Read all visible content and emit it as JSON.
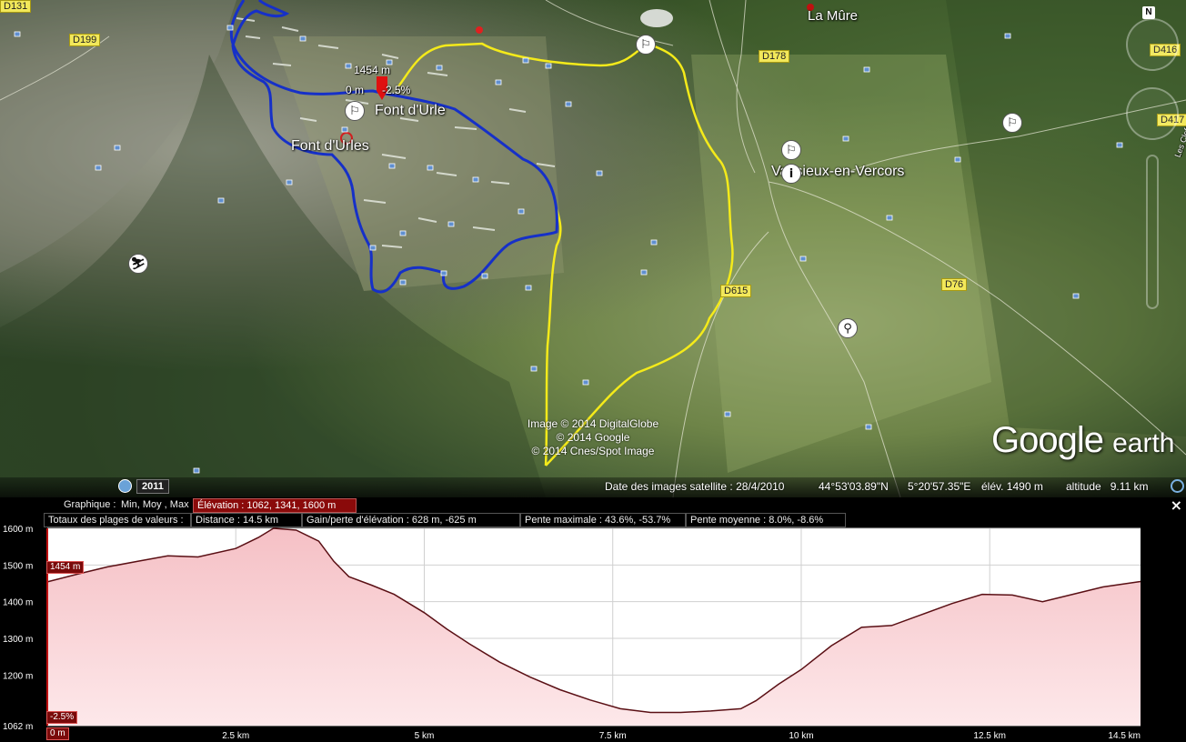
{
  "map": {
    "road_labels": [
      {
        "name": "road-label-d131",
        "text": "D131",
        "pos": "top-left corner"
      },
      {
        "name": "road-label-d199",
        "text": "D199"
      },
      {
        "name": "road-label-d178",
        "text": "D178"
      },
      {
        "name": "road-label-d416",
        "text": "D416"
      },
      {
        "name": "road-label-d417",
        "text": "D417"
      },
      {
        "name": "road-label-d615",
        "text": "D615"
      },
      {
        "name": "road-label-d76",
        "text": "D76"
      }
    ],
    "places": {
      "la_mure": "La Mûre",
      "font_durle": "Font d'Urle",
      "font_durles": "Font d'Urles",
      "vassieux": "Vassieux-en-Vercors",
      "les_clefs": "Les Clefs"
    },
    "track_marker": {
      "elevation": "1454 m",
      "distance": "0 m",
      "slope": "-2.5%"
    },
    "copyright": {
      "line1": "Image © 2014 DigitalGlobe",
      "line2": "© 2014 Google",
      "line3": "© 2014 Cnes/Spot Image"
    },
    "brand": {
      "google": "Google",
      "earth": "earth"
    },
    "year": "2011",
    "north": "N",
    "icons": [
      "hiking-icon",
      "ski-icon",
      "cycling-icon",
      "info-icon",
      "camera-icon"
    ]
  },
  "status": {
    "image_date": "Date des images satellite : 28/4/2010",
    "lat": "44°53'03.89\"N",
    "lon": "5°20'57.35\"E",
    "elev": "élév. 1490 m",
    "altitude": "altitude   9.11 km"
  },
  "profile": {
    "row1": {
      "graph_label": "Graphique :",
      "stats": "Min, Moy , Max",
      "elevation": "Élévation : 1062, 1341, 1600 m"
    },
    "row2": {
      "totals_label": "Totaux des plages de valeurs :",
      "distance": "Distance : 14.5 km",
      "gain_loss": "Gain/perte d'élévation : 628 m, -625 m",
      "max_slope": "Pente maximale : 43.6%, -53.7%",
      "avg_slope": "Pente moyenne : 8.0%, -8.6%"
    },
    "close": "×",
    "cursor_elev": "1454 m",
    "cursor_slope": "-2.5%",
    "cursor_dist": "0 m",
    "colors": {
      "fill_top": "#f7c8cc",
      "fill_bottom": "#fbe4e6",
      "line": "#5a0f14",
      "accent": "#8a0a0a"
    }
  },
  "chart_data": {
    "type": "area",
    "title": "",
    "xlabel": "",
    "ylabel": "",
    "x_unit": "km",
    "y_unit": "m",
    "xlim": [
      0,
      14.5
    ],
    "ylim": [
      1062,
      1600
    ],
    "y_ticks": [
      {
        "value": 1600,
        "label": "1600 m"
      },
      {
        "value": 1500,
        "label": "1500 m"
      },
      {
        "value": 1400,
        "label": "1400 m"
      },
      {
        "value": 1300,
        "label": "1300 m"
      },
      {
        "value": 1200,
        "label": "1200 m"
      },
      {
        "value": 1062,
        "label": "1062 m"
      }
    ],
    "x_ticks": [
      {
        "value": 0,
        "label": "0 m"
      },
      {
        "value": 2.5,
        "label": "2.5 km"
      },
      {
        "value": 5,
        "label": "5 km"
      },
      {
        "value": 7.5,
        "label": "7.5 km"
      },
      {
        "value": 10,
        "label": "10 km"
      },
      {
        "value": 12.5,
        "label": "12.5 km"
      },
      {
        "value": 14.5,
        "label": "14.5 km"
      }
    ],
    "grid": true,
    "series": [
      {
        "x": [
          0,
          0.4,
          0.8,
          1.2,
          1.6,
          2.0,
          2.5,
          2.8,
          3.0,
          3.3,
          3.6,
          3.8,
          4.0,
          4.3,
          4.6,
          5.0,
          5.3,
          5.6,
          6.0,
          6.4,
          6.8,
          7.2,
          7.6,
          8.0,
          8.4,
          8.8,
          9.2,
          9.4,
          9.7,
          10.0,
          10.4,
          10.8,
          11.2,
          11.6,
          12.0,
          12.4,
          12.8,
          13.2,
          13.6,
          14.0,
          14.5
        ],
        "y": [
          1454,
          1475,
          1495,
          1510,
          1525,
          1522,
          1545,
          1575,
          1600,
          1595,
          1565,
          1510,
          1468,
          1445,
          1420,
          1370,
          1325,
          1285,
          1235,
          1195,
          1160,
          1132,
          1108,
          1098,
          1098,
          1102,
          1108,
          1130,
          1175,
          1215,
          1280,
          1330,
          1335,
          1365,
          1395,
          1420,
          1418,
          1400,
          1420,
          1440,
          1455
        ]
      }
    ]
  }
}
